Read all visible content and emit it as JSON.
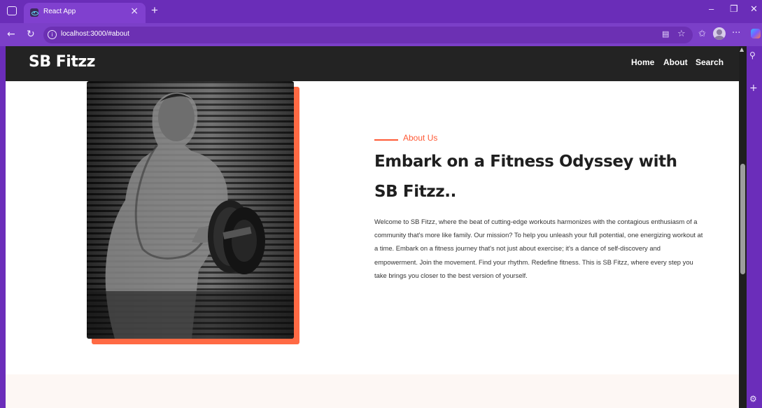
{
  "browser": {
    "tab_title": "React App",
    "tab_close": "×",
    "new_tab": "+",
    "url": "localhost:3000/#about",
    "win_minimize": "–",
    "win_restore": "❐",
    "win_close": "✕",
    "menu_dots": "···"
  },
  "site": {
    "logo": "SB Fitzz",
    "nav": [
      {
        "label": "Home"
      },
      {
        "label": "About"
      },
      {
        "label": "Search"
      }
    ]
  },
  "about": {
    "label": "About Us",
    "title": "Embark on a Fitness Odyssey with SB Fitzz..",
    "text": "Welcome to SB Fitzz, where the beat of cutting-edge workouts harmonizes with the contagious enthusiasm of a community that's more like family. Our mission? To help you unleash your full potential, one energizing workout at a time. Embark on a fitness journey that's not just about exercise; it's a dance of self-discovery and empowerment. Join the movement. Find your rhythm. Redefine fitness. This is SB Fitzz, where every step you take brings you closer to the best version of yourself."
  },
  "colors": {
    "accent": "#ff5a36",
    "header_bg": "#232323",
    "browser_chrome": "#6a2db8"
  },
  "icons": [
    "sidebar-toggle-icon",
    "react-favicon-icon",
    "back-arrow-icon",
    "refresh-icon",
    "info-icon",
    "reader-mode-icon",
    "favorite-star-icon",
    "favorites-icon",
    "profile-icon",
    "more-icon",
    "copilot-icon",
    "search-icon",
    "add-icon",
    "settings-icon"
  ]
}
